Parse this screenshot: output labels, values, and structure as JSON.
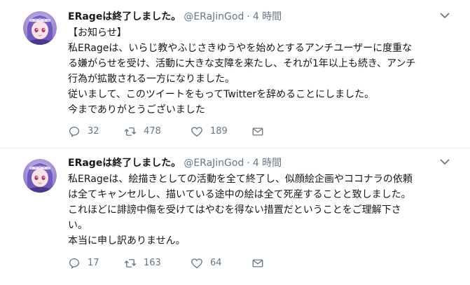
{
  "colors": {
    "text": "#14171a",
    "meta": "#657786",
    "divider": "#e6ecf0"
  },
  "icons": [
    "avatar-image",
    "chevron-down-icon",
    "reply-icon",
    "retweet-icon",
    "heart-icon",
    "dm-envelope-icon"
  ],
  "tweets": [
    {
      "name": "ERageは終了しました。",
      "handle": "@ERaJinGod",
      "separator": "·",
      "time": "4 時間",
      "lines": [
        "【お知らせ】",
        "私ERageは、いらじ教やふじさきゆうやを始めとするアンチユーザーに度重な",
        "る嫌がらせを受け、活動に大きな支障を来たし、それが1年以上も続き、アンチ",
        "行為が拡散される一方になりました。",
        "従いまして、このツイートをもってTwitterを辞めることにしました。",
        "今までありがとうございました"
      ],
      "replies": "32",
      "retweets": "478",
      "likes": "189"
    },
    {
      "name": "ERageは終了しました。",
      "handle": "@ERaJinGod",
      "separator": "·",
      "time": "4 時間",
      "lines": [
        "私ERageは、絵描きとしての活動を全て終了し、似顔絵企画やココナラの依頼",
        "は全てキャンセルし、描いている途中の絵は全て死産することと致しました。",
        "これほどに誹謗中傷を受けてはやむを得ない措置だということをご理解下さ",
        "い。",
        "本当に申し訳ありません。"
      ],
      "replies": "17",
      "retweets": "163",
      "likes": "64"
    }
  ]
}
